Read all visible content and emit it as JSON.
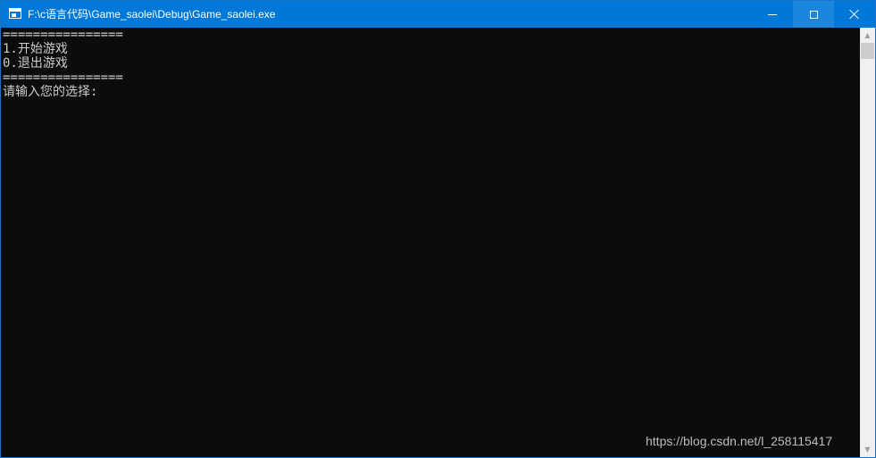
{
  "window": {
    "title": "F:\\c语言代码\\Game_saolei\\Debug\\Game_saolei.exe",
    "accent_color": "#0078d7",
    "console_bg": "#0c0c0c",
    "console_fg": "#cccccc"
  },
  "caption_buttons": {
    "minimize_icon": "minimize-icon",
    "maximize_icon": "maximize-icon",
    "close_icon": "close-icon"
  },
  "console": {
    "lines": [
      "================",
      "1.开始游戏",
      "0.退出游戏",
      "================",
      "请输入您的选择:"
    ]
  },
  "scrollbar": {
    "up_icon": "scroll-up-arrow-icon",
    "down_icon": "scroll-down-arrow-icon"
  },
  "watermark": {
    "text": "https://blog.csdn.net/l_258115417"
  }
}
